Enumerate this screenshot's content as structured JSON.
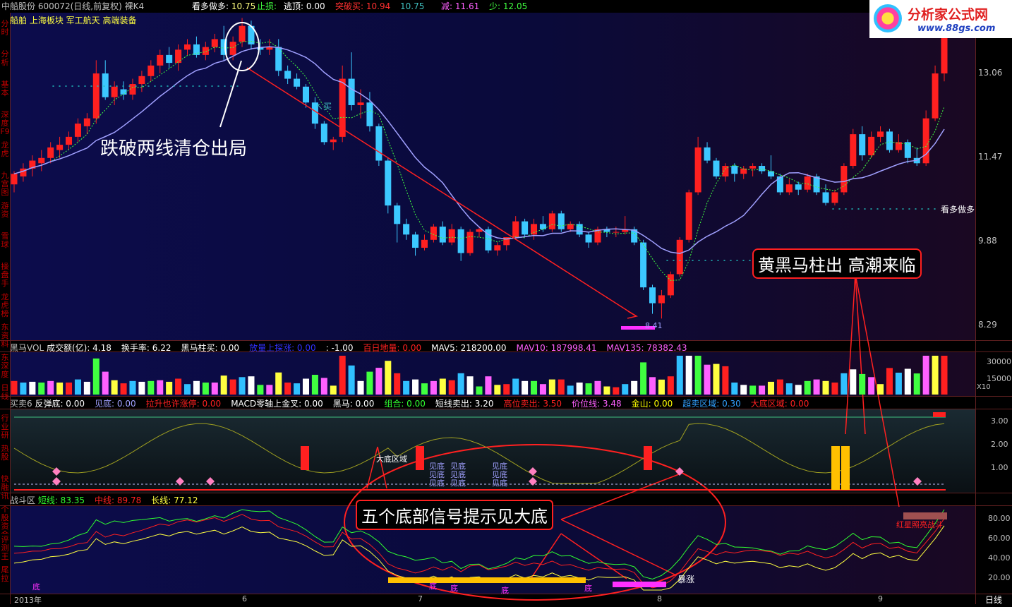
{
  "header": {
    "stock": "中船股份 600072(日线,前复权) 裸K4",
    "kan_duo_label": "看多做多:",
    "kan_duo_value": "10.75",
    "zhi_sun_label": "止损:",
    "tao_ding_label": "逃顶:",
    "tao_ding_value": "0.00",
    "tu_po_label": "突破买:",
    "tu_po_value": "10.94",
    "extra_value": "10.75",
    "jian_label": "减:",
    "jian_value": "11.61",
    "shao_label": "少:",
    "shao_value": "12.05",
    "concepts": "船舶 上海板块 军工航天 高端装备"
  },
  "logo": {
    "name": "分析家公式网",
    "url": "www.88gs.com"
  },
  "sidebar": {
    "items": [
      "分时",
      "分析",
      "基本",
      "深度F9",
      "龙虎",
      "九宫图",
      "游资",
      "雪球",
      "操盘手",
      "龙虎榜",
      "东资料",
      "东深度",
      "日线",
      "行业研",
      "热股",
      "快融讯",
      "个股资金",
      "评测王",
      "尾拉"
    ]
  },
  "annotations": {
    "sell_note": "跌破两线清仓出局",
    "horse_note": "黄黑马柱出 高潮来临",
    "bottom_note": "五个底部信号提示见大底",
    "buy_mark": "↖买",
    "kan_duo_line": "看多做多",
    "low_price": "8.41",
    "big_bottom_zone": "大底区域",
    "jian_di": "见底",
    "bao_zhang": "暴涨",
    "di": "底",
    "red_star_battle": "红星照亮战斗"
  },
  "panels": {
    "vol": {
      "title": "黑马VOL",
      "items": [
        {
          "label": "成交额(亿):",
          "value": "4.18",
          "color": "#ffffff"
        },
        {
          "label": "换手率:",
          "value": "6.22",
          "color": "#ffffff"
        },
        {
          "label": "黑马柱买:",
          "value": "0.00",
          "color": "#ffffff"
        },
        {
          "label": "放量上探涨:",
          "value": "0.00",
          "color": "#3030ff"
        },
        {
          "label": ":",
          "value": "-1.00",
          "color": "#ffffff"
        },
        {
          "label": "百日地量:",
          "value": "0.00",
          "color": "#ff2020"
        },
        {
          "label": "MAV5:",
          "value": "218200.00",
          "color": "#ffffff"
        },
        {
          "label": "MAV10:",
          "value": "187998.41",
          "color": "#ff60ff"
        },
        {
          "label": "MAV135:",
          "value": "78382.43",
          "color": "#ff60ff"
        }
      ]
    },
    "mm": {
      "title": "买卖6",
      "items": [
        {
          "label": "反弹底:",
          "value": "0.00",
          "color": "#ffffff"
        },
        {
          "label": "见底:",
          "value": "0.00",
          "color": "#a0a0ff"
        },
        {
          "label": "拉升也许涨停:",
          "value": "0.00",
          "color": "#ff2020"
        },
        {
          "label": "MACD零轴上金叉:",
          "value": "0.00",
          "color": "#ffffff"
        },
        {
          "label": "黑马:",
          "value": "0.00",
          "color": "#ffffff"
        },
        {
          "label": "组合:",
          "value": "0.00",
          "color": "#30ff30"
        },
        {
          "label": "短线卖出:",
          "value": "3.20",
          "color": "#ffffff"
        },
        {
          "label": "高位卖出:",
          "value": "3.50",
          "color": "#ff2020"
        },
        {
          "label": "价位线:",
          "value": "3.48",
          "color": "#ff60ff"
        },
        {
          "label": "金山:",
          "value": "0.00",
          "color": "#ffff00"
        },
        {
          "label": "超卖区域:",
          "value": "0.30",
          "color": "#30a0ff"
        },
        {
          "label": "大底区域:",
          "value": "0.00",
          "color": "#ff2020"
        }
      ]
    },
    "zd": {
      "title": "战斗区",
      "items": [
        {
          "label": "短线:",
          "value": "83.35",
          "color": "#30ff30"
        },
        {
          "label": "中线:",
          "value": "89.78",
          "color": "#ff2020"
        },
        {
          "label": "长线:",
          "value": "77.12",
          "color": "#ffff40"
        }
      ]
    }
  },
  "axes": {
    "price_ticks": [
      "13.06",
      "11.47",
      "9.88",
      "8.29"
    ],
    "vol_ticks": [
      "30000",
      "15000"
    ],
    "vol_unit": "X10",
    "mm_ticks": [
      "3.00",
      "2.00",
      "1.00"
    ],
    "zd_ticks": [
      "80.00",
      "60.00",
      "40.00",
      "20.00"
    ],
    "x_labels": [
      "2013年",
      "6",
      "7",
      "8",
      "9"
    ],
    "period": "日线"
  },
  "colors": {
    "up": "#ff2020",
    "down": "#3cc8ff",
    "bg": "#000000"
  },
  "chart_data": {
    "type": "candlestick",
    "y_range": [
      8.0,
      14.2
    ],
    "x_months": [
      "2013-05",
      "2013-06",
      "2013-07",
      "2013-08",
      "2013-09"
    ],
    "candles": [
      [
        10.95,
        11.2,
        10.8,
        11.15
      ],
      [
        11.1,
        11.35,
        11.0,
        11.25
      ],
      [
        11.25,
        11.5,
        11.1,
        11.4
      ],
      [
        11.35,
        11.6,
        11.2,
        11.45
      ],
      [
        11.45,
        11.75,
        11.35,
        11.65
      ],
      [
        11.6,
        11.85,
        11.45,
        11.7
      ],
      [
        11.7,
        11.95,
        11.6,
        11.85
      ],
      [
        11.85,
        12.2,
        11.75,
        12.1
      ],
      [
        12.05,
        12.3,
        11.9,
        12.2
      ],
      [
        12.2,
        13.3,
        12.1,
        13.05
      ],
      [
        13.05,
        13.3,
        12.55,
        12.6
      ],
      [
        12.6,
        12.9,
        12.45,
        12.8
      ],
      [
        12.75,
        12.9,
        12.55,
        12.65
      ],
      [
        12.65,
        12.95,
        12.55,
        12.85
      ],
      [
        12.85,
        13.1,
        12.7,
        13.0
      ],
      [
        13.0,
        13.3,
        12.9,
        13.2
      ],
      [
        13.2,
        13.5,
        13.05,
        13.4
      ],
      [
        13.4,
        13.55,
        13.15,
        13.25
      ],
      [
        13.25,
        13.6,
        13.1,
        13.5
      ],
      [
        13.5,
        13.7,
        13.4,
        13.6
      ],
      [
        13.6,
        13.75,
        13.35,
        13.4
      ],
      [
        13.4,
        13.65,
        13.3,
        13.55
      ],
      [
        13.55,
        13.8,
        13.45,
        13.7
      ],
      [
        13.7,
        13.95,
        13.3,
        13.4
      ],
      [
        13.4,
        13.75,
        13.3,
        13.65
      ],
      [
        13.65,
        14.1,
        13.55,
        13.95
      ],
      [
        13.95,
        14.05,
        13.5,
        13.6
      ],
      [
        13.55,
        13.7,
        13.4,
        13.5
      ],
      [
        13.5,
        13.7,
        13.4,
        13.55
      ],
      [
        13.55,
        13.7,
        13.0,
        13.1
      ],
      [
        13.1,
        13.2,
        12.85,
        12.95
      ],
      [
        12.95,
        13.05,
        12.75,
        12.8
      ],
      [
        12.8,
        12.85,
        12.4,
        12.5
      ],
      [
        12.5,
        12.6,
        12.0,
        12.1
      ],
      [
        12.1,
        12.15,
        11.7,
        11.75
      ],
      [
        11.75,
        11.85,
        11.6,
        11.8
      ],
      [
        11.85,
        13.2,
        11.75,
        12.95
      ],
      [
        12.95,
        13.45,
        12.35,
        12.45
      ],
      [
        12.45,
        12.75,
        12.2,
        12.5
      ],
      [
        12.5,
        12.7,
        11.95,
        12.05
      ],
      [
        12.05,
        12.1,
        11.3,
        11.4
      ],
      [
        11.4,
        11.45,
        10.4,
        10.55
      ],
      [
        10.55,
        10.6,
        9.85,
        10.2
      ],
      [
        10.2,
        10.3,
        9.9,
        10.0
      ],
      [
        10.0,
        10.05,
        9.6,
        9.75
      ],
      [
        9.75,
        10.0,
        9.7,
        9.9
      ],
      [
        9.9,
        10.2,
        9.85,
        10.15
      ],
      [
        10.15,
        10.25,
        9.8,
        9.85
      ],
      [
        9.85,
        10.2,
        9.8,
        10.1
      ],
      [
        10.1,
        10.15,
        9.5,
        9.65
      ],
      [
        9.65,
        10.1,
        9.6,
        10.05
      ],
      [
        10.05,
        10.15,
        9.95,
        10.1
      ],
      [
        10.1,
        10.15,
        9.65,
        9.7
      ],
      [
        9.7,
        9.85,
        9.6,
        9.8
      ],
      [
        9.8,
        9.95,
        9.7,
        9.95
      ],
      [
        9.95,
        10.35,
        9.9,
        10.25
      ],
      [
        10.25,
        10.3,
        9.95,
        10.0
      ],
      [
        10.0,
        10.3,
        9.9,
        10.2
      ],
      [
        10.2,
        10.35,
        10.05,
        10.1
      ],
      [
        10.1,
        10.45,
        10.05,
        10.4
      ],
      [
        10.4,
        10.45,
        10.05,
        10.1
      ],
      [
        10.1,
        10.25,
        10.05,
        10.2
      ],
      [
        10.2,
        10.25,
        9.95,
        10.0
      ],
      [
        10.0,
        10.05,
        9.75,
        9.85
      ],
      [
        9.85,
        10.15,
        9.8,
        10.1
      ],
      [
        10.1,
        10.15,
        9.95,
        10.05
      ],
      [
        10.05,
        10.15,
        9.95,
        10.05
      ],
      [
        10.05,
        10.35,
        10.0,
        10.1
      ],
      [
        10.1,
        10.15,
        9.8,
        9.85
      ],
      [
        9.85,
        9.9,
        8.95,
        9.0
      ],
      [
        9.0,
        9.05,
        8.5,
        8.7
      ],
      [
        8.7,
        8.95,
        8.41,
        8.85
      ],
      [
        8.85,
        9.3,
        8.8,
        9.25
      ],
      [
        9.25,
        9.95,
        9.2,
        9.9
      ],
      [
        9.9,
        10.85,
        9.85,
        10.8
      ],
      [
        10.8,
        11.85,
        10.75,
        11.65
      ],
      [
        11.65,
        11.75,
        11.35,
        11.4
      ],
      [
        11.4,
        11.45,
        11.05,
        11.1
      ],
      [
        11.1,
        11.35,
        11.0,
        11.3
      ],
      [
        11.3,
        11.35,
        11.0,
        11.15
      ],
      [
        11.15,
        11.3,
        11.05,
        11.25
      ],
      [
        11.25,
        11.35,
        11.1,
        11.3
      ],
      [
        11.3,
        11.35,
        11.15,
        11.2
      ],
      [
        11.2,
        11.5,
        11.05,
        11.1
      ],
      [
        11.1,
        11.15,
        10.75,
        10.8
      ],
      [
        10.8,
        11.05,
        10.75,
        10.95
      ],
      [
        10.95,
        11.0,
        10.75,
        10.85
      ],
      [
        10.85,
        11.15,
        10.8,
        11.1
      ],
      [
        11.1,
        11.15,
        10.75,
        10.8
      ],
      [
        10.8,
        10.95,
        10.55,
        10.6
      ],
      [
        10.6,
        10.85,
        10.55,
        10.8
      ],
      [
        10.8,
        11.35,
        10.75,
        11.3
      ],
      [
        11.3,
        12.0,
        11.25,
        11.9
      ],
      [
        11.9,
        12.05,
        11.4,
        11.5
      ],
      [
        11.5,
        11.95,
        11.45,
        11.85
      ],
      [
        11.85,
        12.05,
        11.75,
        11.95
      ],
      [
        11.95,
        12.0,
        11.55,
        11.6
      ],
      [
        11.6,
        11.9,
        11.55,
        11.75
      ],
      [
        11.75,
        11.8,
        11.35,
        11.45
      ],
      [
        11.45,
        11.65,
        11.3,
        11.35
      ],
      [
        11.35,
        12.35,
        11.3,
        12.2
      ],
      [
        12.2,
        13.2,
        12.15,
        13.05
      ],
      [
        13.05,
        14.15,
        12.9,
        14.05
      ]
    ],
    "ma_fast_start": 0.38,
    "ma_slow_start": 0.25
  }
}
